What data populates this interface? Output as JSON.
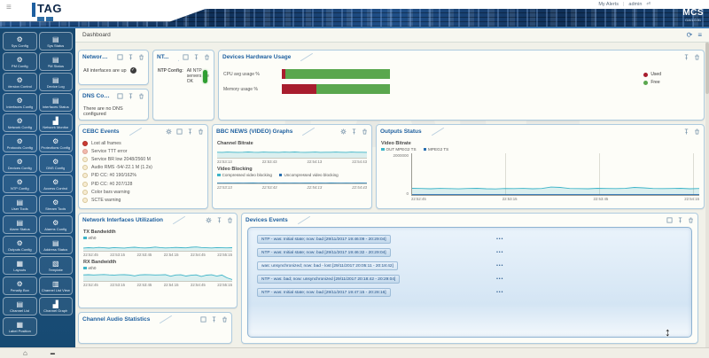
{
  "header": {
    "brand": "TAG",
    "product": "MCS",
    "product_version": "GA/1.0.91",
    "alerts_label": "My Alerts",
    "separator": "|",
    "user": "admin"
  },
  "breadcrumb": {
    "title": "Dashboard"
  },
  "icons": {
    "gear": "⚙",
    "clipboard": "▤",
    "graph": "▟",
    "grid": "▦",
    "layers": "▧",
    "listview": "▥",
    "home": "⌂",
    "hamburger": "≡",
    "refresh": "⟳",
    "check": "✓",
    "dash": "▬",
    "logout": "⏎",
    "resize-vertical": "↕",
    "more": "•••"
  },
  "sidebar": {
    "items": [
      {
        "label": "Sys Config",
        "icon": "gear"
      },
      {
        "label": "Sys Status",
        "icon": "clipboard"
      },
      {
        "label": "PM Config",
        "icon": "gear"
      },
      {
        "label": "PM Status",
        "icon": "clipboard"
      },
      {
        "label": "Version Control",
        "icon": "gear"
      },
      {
        "label": "Device Log",
        "icon": "clipboard"
      },
      {
        "label": "Interfaces Config",
        "icon": "gear"
      },
      {
        "label": "Interfaces Status",
        "icon": "clipboard"
      },
      {
        "label": "Network Config",
        "icon": "gear"
      },
      {
        "label": "Network Monitor",
        "icon": "graph"
      },
      {
        "label": "Protocols Config",
        "icon": "gear"
      },
      {
        "label": "Protections Config",
        "icon": "gear"
      },
      {
        "label": "Devices Config",
        "icon": "gear"
      },
      {
        "label": "DNS Config",
        "icon": "gear"
      },
      {
        "label": "NTP Config",
        "icon": "gear"
      },
      {
        "label": "Access Control",
        "icon": "gear"
      },
      {
        "label": "User Tools",
        "icon": "clipboard"
      },
      {
        "label": "Stream Tools",
        "icon": "gear"
      },
      {
        "label": "Alarm Status",
        "icon": "clipboard"
      },
      {
        "label": "Alarms Config",
        "icon": "gear"
      },
      {
        "label": "Outputs Config",
        "icon": "gear"
      },
      {
        "label": "Address Status",
        "icon": "clipboard"
      },
      {
        "label": "Layouts",
        "icon": "grid"
      },
      {
        "label": "Template",
        "icon": "layers"
      },
      {
        "label": "Penalty Box",
        "icon": "gear"
      },
      {
        "label": "Channel List View",
        "icon": "listview"
      },
      {
        "label": "Channel List",
        "icon": "clipboard"
      },
      {
        "label": "Channel Graph",
        "icon": "graph"
      },
      {
        "label": "Label Position",
        "icon": "grid"
      }
    ]
  },
  "cards": {
    "network_interfaces": {
      "title": "Network Int...",
      "status_text": "All interfaces are up"
    },
    "dns": {
      "title": "DNS Confi...",
      "status_text": "There are no DNS configured"
    },
    "ntp": {
      "title": "NT...",
      "label": "NTP Config:",
      "status_text": "All NTP servers are OK"
    },
    "hardware": {
      "title": "Devices Hardware Usage",
      "rows": [
        {
          "label": "CPU avg usage %",
          "used": 3,
          "free": 97
        },
        {
          "label": "Memory usage %",
          "used": 32,
          "free": 68
        }
      ],
      "legend": [
        {
          "label": "Used",
          "color": "#a81d2e"
        },
        {
          "label": "Free",
          "color": "#5aa74e"
        }
      ]
    },
    "cebc_events": {
      "title": "CEBC Events",
      "events": [
        {
          "label": "Lost all frames",
          "color": "#cc3b33",
          "border": "#a82c25"
        },
        {
          "label": "Service TTT error",
          "color": "#f2b9ad",
          "border": "#dca193"
        },
        {
          "label": "Service BR low 2048/2560 M",
          "color": "#f7ecd2",
          "border": "#d8c79a"
        },
        {
          "label": "Audio RMS -54/-22.1 M (1.2s)",
          "color": "#f7ecd2",
          "border": "#d8c79a"
        },
        {
          "label": "PID CC: #0 190/162%",
          "color": "#f7ecd2",
          "border": "#d8c79a"
        },
        {
          "label": "PID CC: #0 207/128",
          "color": "#f7ecd2",
          "border": "#d8c79a"
        },
        {
          "label": "Color bars warning",
          "color": "#f7ecd2",
          "border": "#d8c79a"
        },
        {
          "label": "SCTE warning",
          "color": "#f7ecd2",
          "border": "#d8c79a"
        }
      ]
    },
    "bbc_graphs": {
      "title": "BBC NEWS (VIDEO) Graphs",
      "section1": "Channel Bitrate",
      "section2": "Video Blocking"
    },
    "outputs": {
      "title": "Outputs Status",
      "subtitle": "Video Bitrate"
    },
    "net_util": {
      "title": "Network Interfaces Utilization",
      "section1": "TX Bandwidth",
      "section2": "RX Bandwidth"
    },
    "devices_events": {
      "title": "Devices Events",
      "rows": [
        {
          "text": "NTP - was: Initial state; now: bad [29/11/2017 19:46:09 - 20:29:04]",
          "style": "normal"
        },
        {
          "text": "NTP - was: Initial state; now: bad [29/11/2017 19:46:32 - 20:29:04]",
          "style": "normal"
        },
        {
          "text": "was: unsynchronized; now: bad - lost [29/11/2017 20:05:11 - 20:18:42]",
          "style": "light"
        },
        {
          "text": "NTP - was: bad; now: unsynchronized [29/11/2017 20:18:42 - 20:29:04]",
          "style": "normal"
        },
        {
          "text": "NTP - was: Initial state; now: bad [29/11/2017 19:47:15 - 20:28:16]",
          "style": "normal"
        }
      ],
      "more": "•••"
    },
    "audio_stats": {
      "title": "Channel Audio Statistics"
    }
  },
  "chart_data": {
    "bbc_bitrate": {
      "type": "line",
      "title": "Channel Bitrate",
      "ylim": [
        0,
        10
      ],
      "grid": false,
      "x_ticks": [
        "22:53:13",
        "22:53:43",
        "22:54:13",
        "22:54:43"
      ],
      "series": [
        {
          "name": "bitrate",
          "color": "#3db4c8",
          "fill": true,
          "values": [
            5.2,
            5.1,
            5.3,
            5.2,
            5.1,
            5.2,
            5.4,
            5.2,
            5.1,
            5.3,
            5.2,
            5.2,
            5.1,
            5.3,
            5.2,
            5.4,
            5.2,
            5.1,
            5.2,
            5.3,
            5.1,
            5.2,
            5.2,
            5.3,
            5.2,
            5.1,
            5.3,
            5.2,
            5.2,
            5.1
          ]
        }
      ]
    },
    "video_blocking": {
      "type": "line",
      "title": "Video Blocking",
      "ylim": [
        0,
        10
      ],
      "grid": false,
      "x_ticks": [
        "22:53:13",
        "22:53:43",
        "22:54:13",
        "22:54:43"
      ],
      "legend": [
        {
          "label": "Compressed video blocking",
          "color": "#3db4c8"
        },
        {
          "label": "Uncompressed video blocking",
          "color": "#2a6fb0"
        }
      ],
      "series": [
        {
          "name": "compressed",
          "color": "#3db4c8",
          "fill": false,
          "values": [
            0.6,
            0.5,
            0.7,
            0.5,
            0.6,
            0.5,
            0.6,
            0.8,
            0.5,
            0.6,
            0.5,
            0.7,
            0.5,
            0.6,
            0.5,
            0.6,
            0.5,
            0.7,
            0.6,
            0.5,
            0.6,
            0.5,
            0.8,
            0.6,
            0.5,
            0.6,
            0.5,
            0.6,
            0.7,
            0.5
          ]
        },
        {
          "name": "uncompressed",
          "color": "#2a6fb0",
          "fill": false,
          "values": [
            0.3,
            0.3,
            0.3,
            0.3,
            0.3,
            0.3,
            0.3,
            0.3,
            0.3,
            0.3,
            0.3,
            0.3,
            0.3,
            0.3,
            0.3,
            0.3,
            0.3,
            0.3,
            0.3,
            0.3,
            0.3,
            0.3,
            0.3,
            0.3,
            0.3,
            0.3,
            0.3,
            0.3,
            0.3,
            0.3
          ]
        }
      ]
    },
    "outputs_video_bitrate": {
      "type": "area",
      "title": "Video Bitrate",
      "ylim": [
        0,
        2000000
      ],
      "grid": true,
      "y_ticks": [
        "2000000",
        "0"
      ],
      "x_ticks": [
        "22:52:45",
        "22:53:15",
        "22:53:45",
        "22:54:15"
      ],
      "legend": [
        {
          "label": "OUT MPEG2 TS",
          "color": "#3db4c8"
        },
        {
          "label": "MPEG2 TS",
          "color": "#2a6fb0"
        }
      ],
      "series": [
        {
          "name": "OUT MPEG2 TS",
          "color": "#3db4c8",
          "fill": true,
          "values": [
            320000,
            310000,
            300000,
            315000,
            305000,
            295000,
            310000,
            320000,
            300000,
            290000,
            310000,
            305000,
            315000,
            300000,
            310000,
            380000,
            360000,
            310000,
            305000,
            300000,
            320000,
            310000,
            305000,
            315000,
            360000,
            340000,
            310000,
            305000,
            310000,
            320000,
            300000,
            310000
          ]
        },
        {
          "name": "MPEG2 TS",
          "color": "#2a6fb0",
          "fill": false,
          "values": [
            15000,
            15000,
            15000,
            15000,
            15000,
            15000,
            15000,
            15000,
            15000,
            15000,
            15000,
            15000,
            15000,
            15000,
            15000,
            15000,
            15000,
            15000,
            15000,
            15000,
            15000,
            15000,
            15000,
            15000,
            15000,
            15000,
            15000,
            15000,
            15000,
            15000,
            15000,
            15000
          ]
        }
      ]
    },
    "tx_bandwidth": {
      "type": "line",
      "title": "TX Bandwidth",
      "ylim": [
        0,
        10
      ],
      "grid": false,
      "legend": [
        {
          "label": "eth0",
          "color": "#3db4c8"
        }
      ],
      "x_ticks": [
        "22:52:45",
        "22:53:15",
        "22:53:45",
        "22:54:15",
        "22:54:45",
        "22:55:15"
      ],
      "series": [
        {
          "name": "eth0",
          "color": "#3db4c8",
          "fill": true,
          "values": [
            2.8,
            3.2,
            2.9,
            3.5,
            3.1,
            2.7,
            3.3,
            3.0,
            2.8,
            3.4,
            3.6,
            3.1,
            2.9,
            3.2,
            3.8,
            3.3,
            2.9,
            3.1,
            3.5,
            3.2,
            3.0,
            3.6,
            3.9,
            3.4,
            3.1,
            2.9,
            3.3,
            3.1,
            3.0,
            3.2
          ]
        }
      ]
    },
    "rx_bandwidth": {
      "type": "line",
      "title": "RX Bandwidth",
      "ylim": [
        0,
        10
      ],
      "grid": false,
      "legend": [
        {
          "label": "eth0",
          "color": "#3db4c8"
        }
      ],
      "x_ticks": [
        "22:52:45",
        "22:53:15",
        "22:53:45",
        "22:54:15",
        "22:54:45",
        "22:55:15"
      ],
      "series": [
        {
          "name": "eth0",
          "color": "#3db4c8",
          "fill": true,
          "values": [
            6.2,
            6.4,
            6.1,
            6.3,
            6.5,
            6.2,
            6.0,
            6.3,
            6.4,
            6.1,
            5.2,
            6.2,
            6.4,
            6.3,
            6.1,
            6.2,
            6.4,
            4.8,
            6.1,
            6.3,
            5.0,
            5.8,
            6.2,
            4.6,
            5.9,
            6.3,
            4.9,
            6.0,
            3.2,
            1.4
          ]
        }
      ]
    },
    "hardware_usage": {
      "type": "bar",
      "title": "Devices Hardware Usage",
      "categories": [
        "CPU avg usage %",
        "Memory usage %"
      ],
      "series": [
        {
          "name": "Used",
          "color": "#a81d2e",
          "values": [
            3,
            32
          ]
        },
        {
          "name": "Free",
          "color": "#5aa74e",
          "values": [
            97,
            68
          ]
        }
      ],
      "xlim": [
        0,
        100
      ]
    }
  }
}
